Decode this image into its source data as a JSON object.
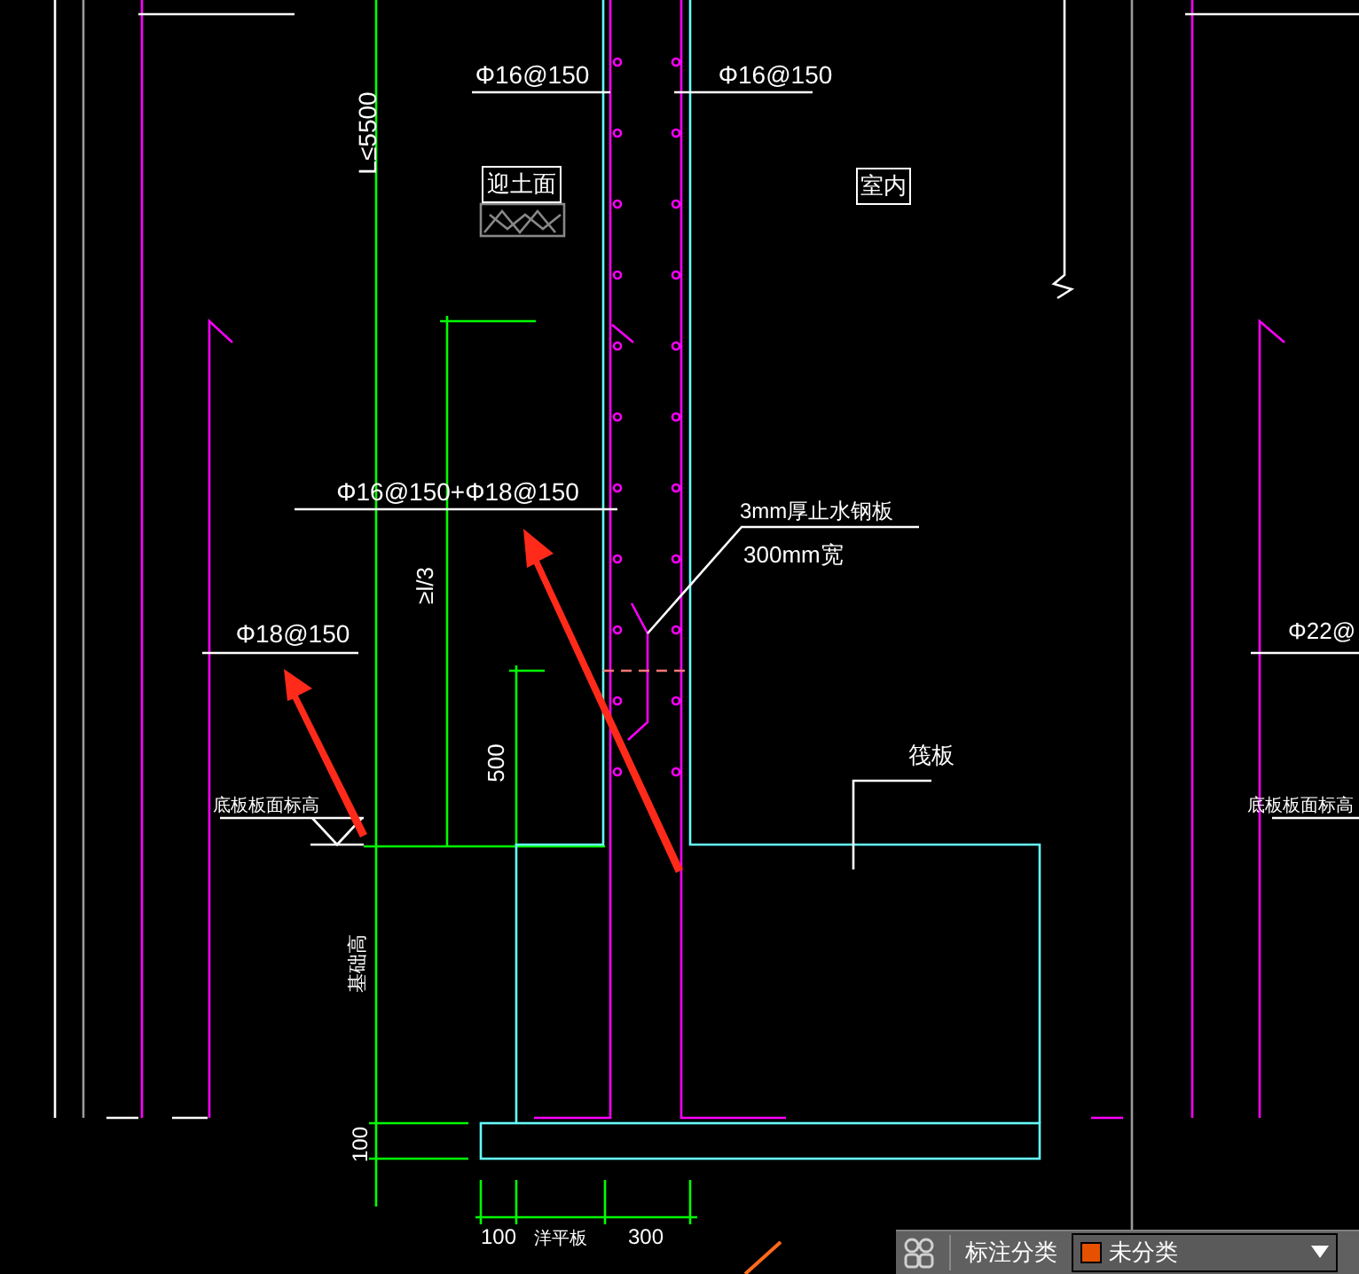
{
  "drawing": {
    "labels": [
      {
        "text": "Φ16@150"
      },
      {
        "text": "Φ16@150"
      },
      {
        "text": "L≤5500"
      },
      {
        "text": "迎土面"
      },
      {
        "text": "室内"
      },
      {
        "text": "Φ16@150+Φ18@150"
      },
      {
        "text": "3mm厚止水钢板"
      },
      {
        "text": "300mm宽"
      },
      {
        "text": "≥l/3"
      },
      {
        "text": "Φ18@150"
      },
      {
        "text": "500"
      },
      {
        "text": "筏板"
      },
      {
        "text": "底板板面标高"
      },
      {
        "text": "基础高"
      },
      {
        "text": "100"
      },
      {
        "text": "100"
      },
      {
        "text": "洋平板"
      },
      {
        "text": "300"
      },
      {
        "text": "Φ22@"
      },
      {
        "text": "底板板面标高"
      }
    ]
  },
  "toolbar": {
    "label": "标注分类",
    "category": {
      "value": "未分类",
      "color": "#e65100"
    }
  }
}
